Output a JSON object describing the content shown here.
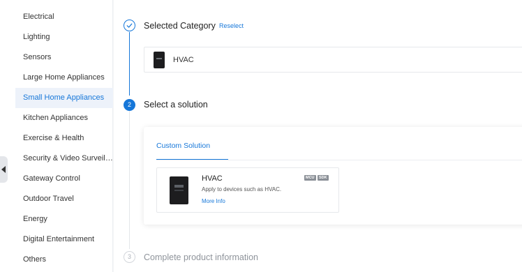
{
  "sidebar": {
    "items": [
      {
        "label": "Electrical",
        "active": false
      },
      {
        "label": "Lighting",
        "active": false
      },
      {
        "label": "Sensors",
        "active": false
      },
      {
        "label": "Large Home Appliances",
        "active": false
      },
      {
        "label": "Small Home Appliances",
        "active": true
      },
      {
        "label": "Kitchen Appliances",
        "active": false
      },
      {
        "label": "Exercise & Health",
        "active": false
      },
      {
        "label": "Security & Video Surveill...",
        "active": false
      },
      {
        "label": "Gateway Control",
        "active": false
      },
      {
        "label": "Outdoor Travel",
        "active": false
      },
      {
        "label": "Energy",
        "active": false
      },
      {
        "label": "Digital Entertainment",
        "active": false
      },
      {
        "label": "Others",
        "active": false
      }
    ],
    "collapse_icon": "chevron-left-icon"
  },
  "steps": [
    {
      "number": "1",
      "title": "Selected Category",
      "status": "done",
      "icon": "check-icon"
    },
    {
      "number": "2",
      "title": "Select a solution",
      "status": "active"
    },
    {
      "number": "3",
      "title": "Complete product information",
      "status": "todo"
    }
  ],
  "selected_category": {
    "reselect_label": "Reselect",
    "name": "HVAC"
  },
  "solution": {
    "tab_label": "Custom Solution",
    "card": {
      "name": "HVAC",
      "description": "Apply to devices such as HVAC.",
      "more_label": "More Info",
      "badges": [
        "MCU",
        "SDK"
      ]
    }
  },
  "colors": {
    "accent": "#1677d9",
    "active_bg": "#edf2fa",
    "muted": "#8f949b"
  }
}
